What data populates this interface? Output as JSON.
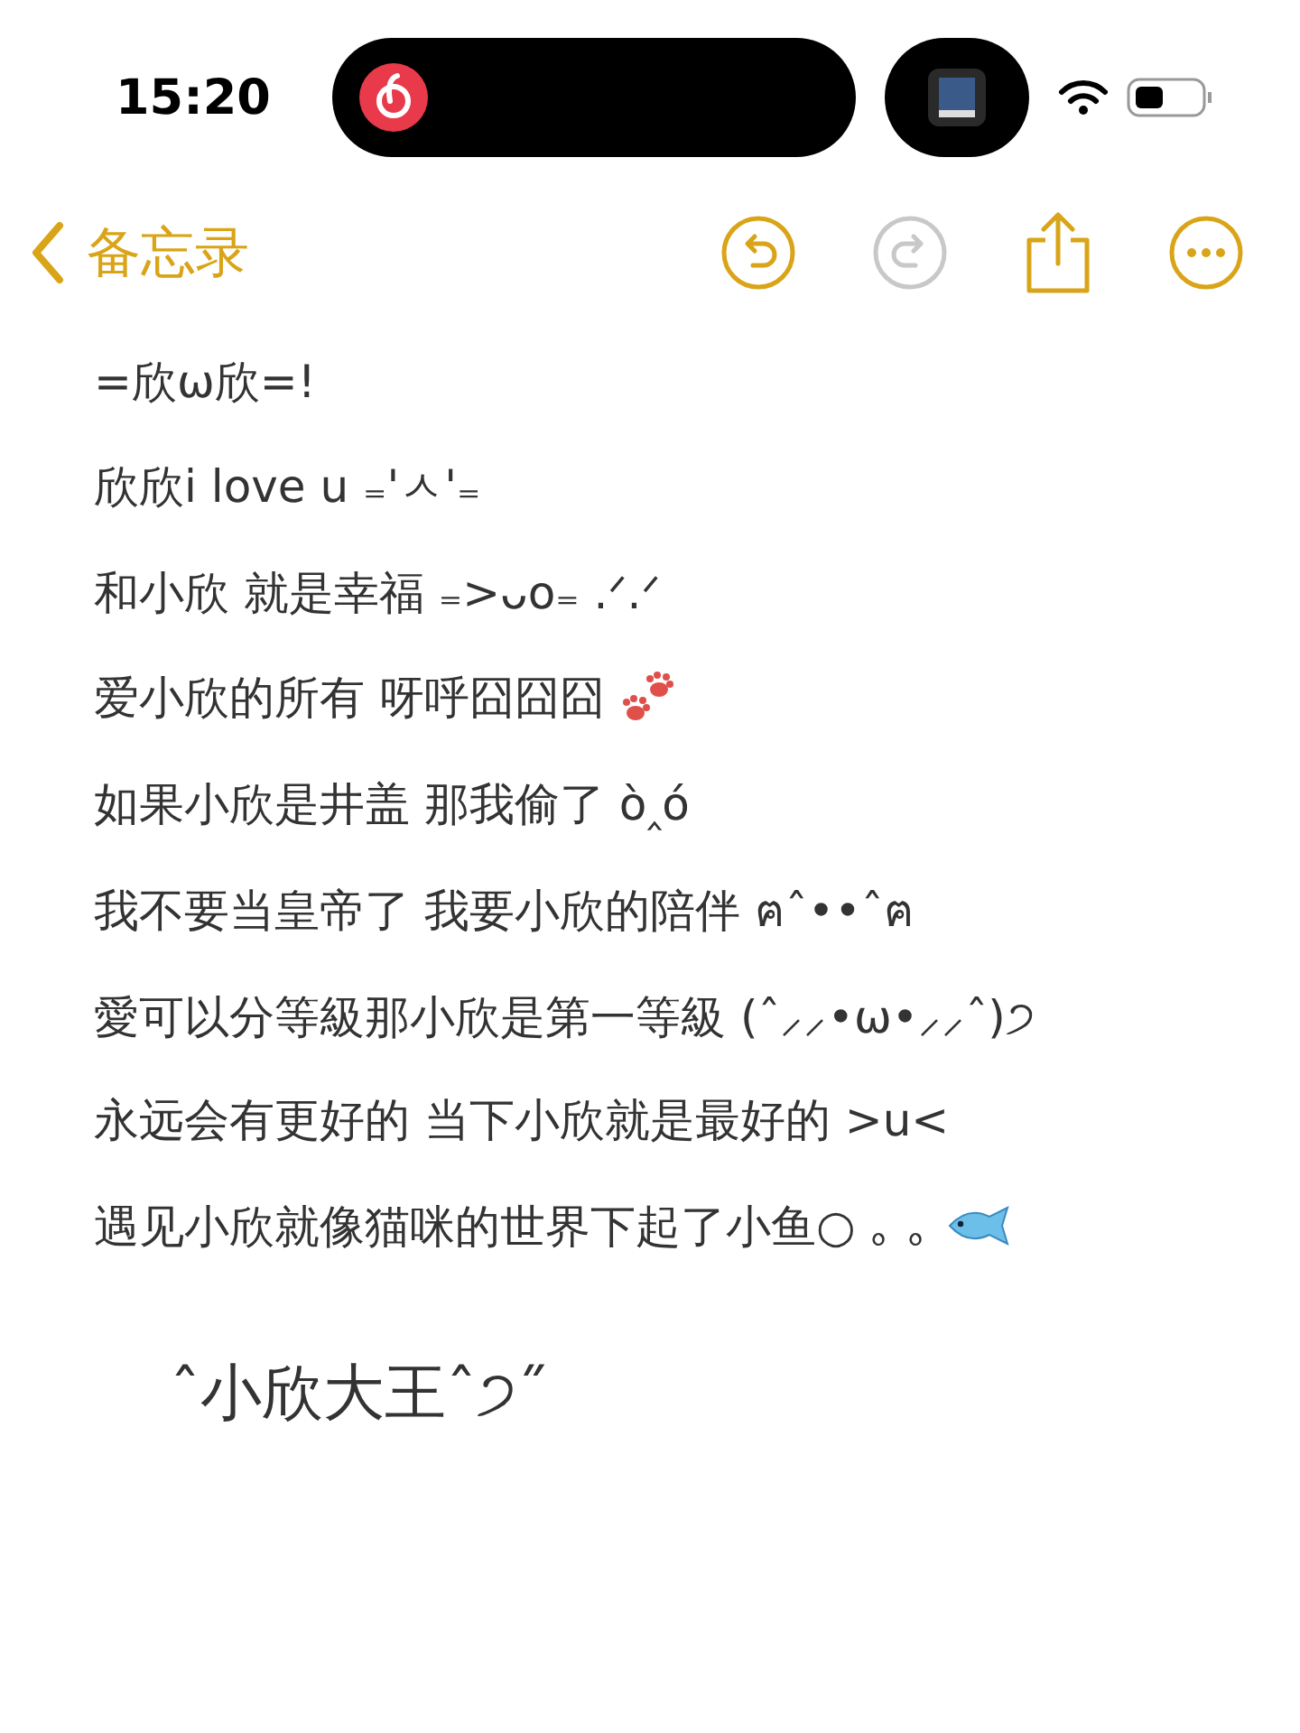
{
  "status_bar": {
    "time": "15:20"
  },
  "nav": {
    "back_label": "备忘录"
  },
  "note": {
    "lines": [
      {
        "text": "=欣ω欣=!"
      },
      {
        "text": "欣欣i love u ₌'ㅅ'₌"
      },
      {
        "text": "和小欣 就是幸福 ₌>ᴗo₌ .ᐟ.ᐟ"
      },
      {
        "text": "爱小欣的所有 呀呼囧囧囧",
        "kind": "paws"
      },
      {
        "text": "如果小欣是井盖 那我偷了 ò‸ó"
      },
      {
        "text": "我不要当皇帝了 我要小欣的陪伴 ฅˆ••ˆฅ"
      },
      {
        "text": "愛可以分等級那小欣是第一等級 (ˆ⸝⸝•ω•⸝⸝ˆ)੭"
      },
      {
        "text": "永远会有更好的 当下小欣就是最好的 >u<"
      },
      {
        "text": "遇见小欣就像猫咪的世界下起了小鱼○ ｡ ｡",
        "kind": "fish"
      }
    ],
    "signature": "ˆ小欣大王ˆ੭˝"
  }
}
